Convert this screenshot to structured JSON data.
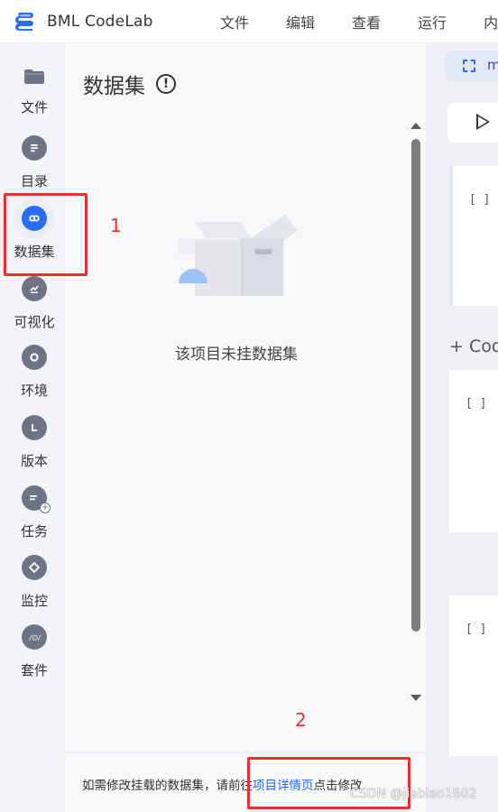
{
  "app": {
    "name": "BML CodeLab"
  },
  "menu": [
    "文件",
    "编辑",
    "查看",
    "运行",
    "内"
  ],
  "sidebar": {
    "items": [
      {
        "label": "文件",
        "icon": "folder-icon"
      },
      {
        "label": "目录",
        "icon": "list-icon"
      },
      {
        "label": "数据集",
        "icon": "link-icon",
        "active": true
      },
      {
        "label": "可视化",
        "icon": "chart-icon"
      },
      {
        "label": "环境",
        "icon": "circle-icon"
      },
      {
        "label": "版本",
        "icon": "version-icon"
      },
      {
        "label": "任务",
        "icon": "task-add-icon"
      },
      {
        "label": "监控",
        "icon": "diamond-icon"
      },
      {
        "label": "套件",
        "icon": "plugin-icon"
      }
    ]
  },
  "panel": {
    "title": "数据集",
    "info_glyph": "!",
    "empty_text": "该项目未挂数据集",
    "footer_prefix": "如需修改挂载的数据集，请前往",
    "footer_link": "项目详情页",
    "footer_suffix": "点击修改"
  },
  "notebook": {
    "tab_label": "m",
    "add_code_label": "+ Cod",
    "cell_bracket": "[ ]"
  },
  "annotations": {
    "num1": "1",
    "num2": "2"
  },
  "watermark": "CSDN @jiabiao1602",
  "colors": {
    "accent": "#2b6cf0",
    "link": "#2468f2",
    "annotation": "#e8302a",
    "icon_gray": "#6c7486"
  }
}
